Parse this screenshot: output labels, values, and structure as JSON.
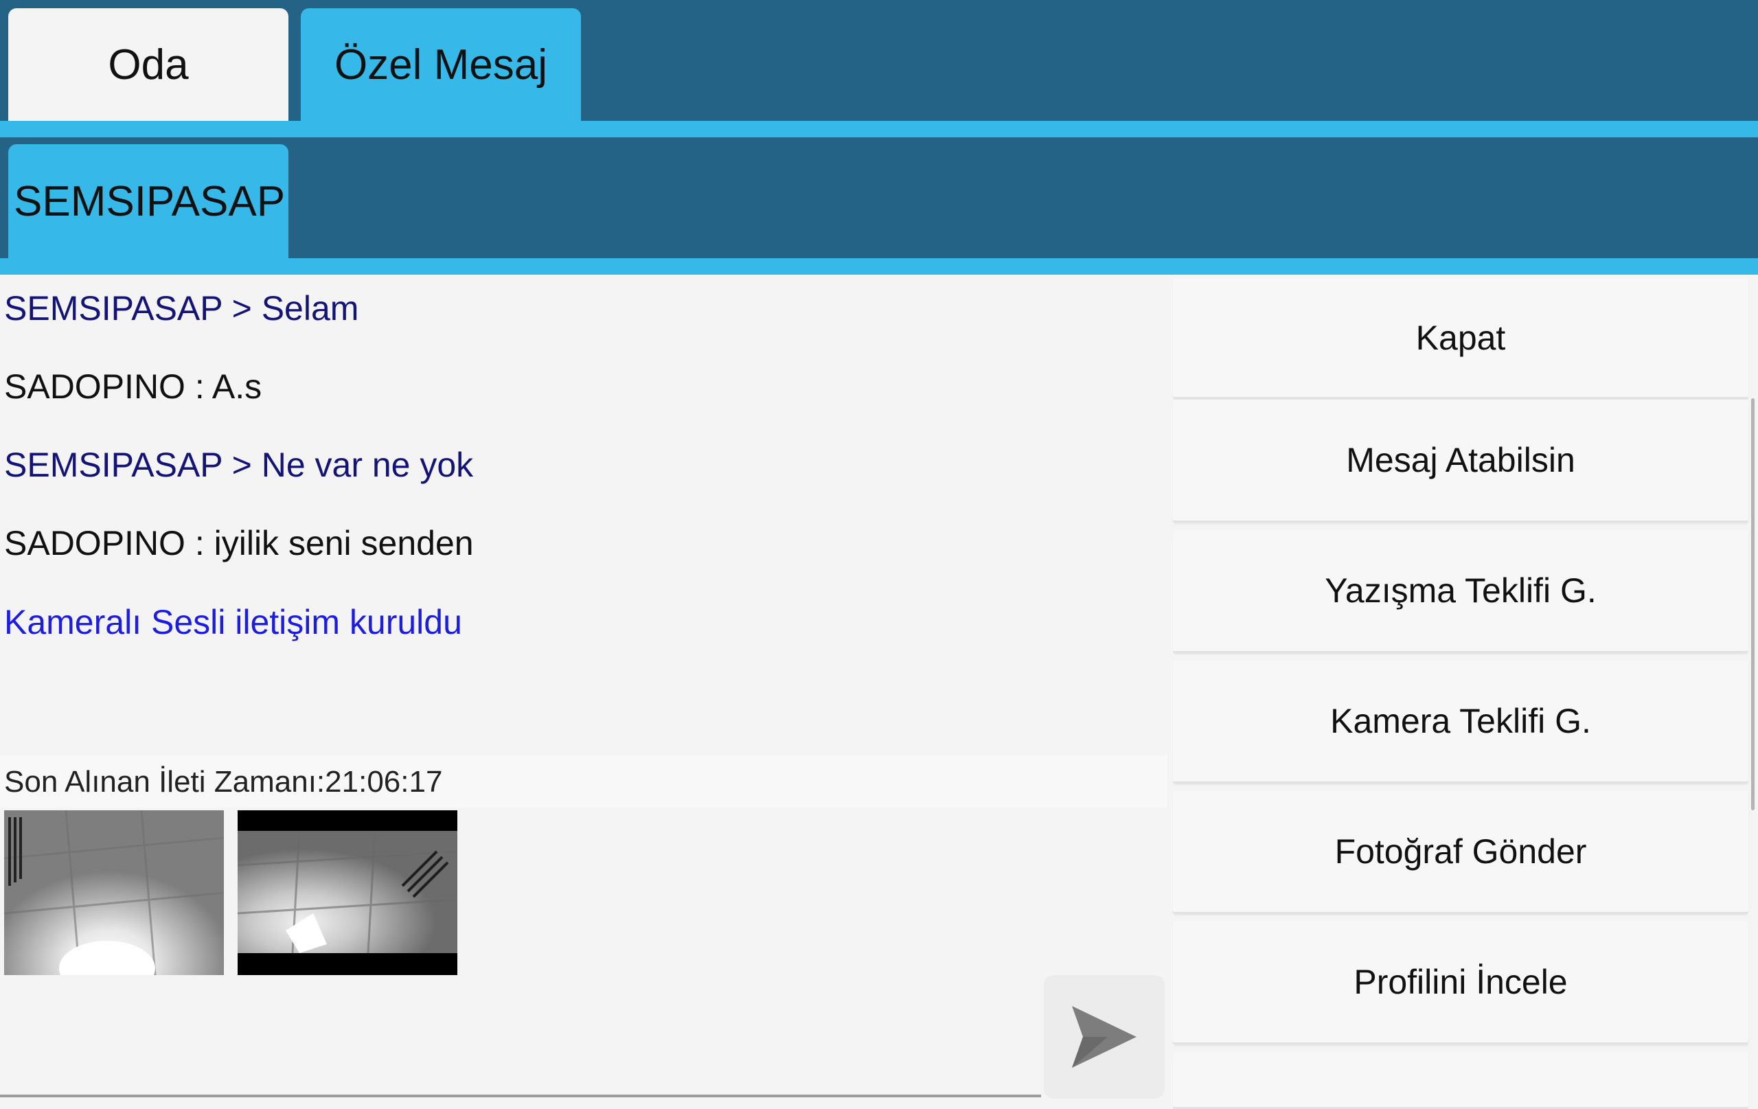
{
  "tabs": [
    {
      "label": "Oda",
      "active": false
    },
    {
      "label": "Özel Mesaj",
      "active": true
    }
  ],
  "private_tab": {
    "label": "SEMSIPASAP"
  },
  "messages": [
    {
      "text": "SEMSIPASAP > Selam",
      "type": "remote"
    },
    {
      "text": "SADOPINO : A.s",
      "type": "local"
    },
    {
      "text": "SEMSIPASAP > Ne var ne yok",
      "type": "remote"
    },
    {
      "text": "SADOPINO : iyilik seni senden",
      "type": "local"
    },
    {
      "text": "Kameralı Sesli iletişim kuruldu",
      "type": "system"
    }
  ],
  "status": {
    "text": "Son Alınan İleti Zamanı:21:06:17"
  },
  "input": {
    "value": "",
    "placeholder": ""
  },
  "send": {
    "icon": "send-icon"
  },
  "menu": [
    {
      "label": "Kapat"
    },
    {
      "label": "Mesaj Atabilsin"
    },
    {
      "label": "Yazışma Teklifi G."
    },
    {
      "label": "Kamera Teklifi G."
    },
    {
      "label": "Fotoğraf Gönder"
    },
    {
      "label": "Profilini İncele"
    }
  ],
  "colors": {
    "header_dark": "#246386",
    "accent": "#36b8e8",
    "remote_text": "#141478",
    "system_text": "#1d1de0"
  }
}
